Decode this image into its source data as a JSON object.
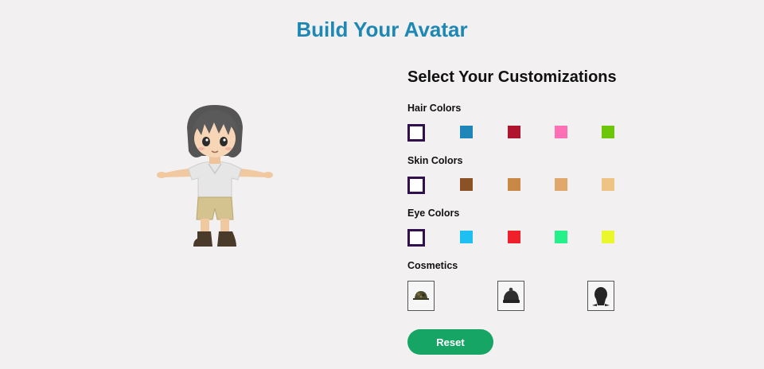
{
  "page": {
    "title": "Build Your Avatar"
  },
  "panel": {
    "title": "Select Your Customizations",
    "hair": {
      "label": "Hair Colors",
      "colors": [
        "#ffffff",
        "#1e86b8",
        "#b0132e",
        "#ff6fb6",
        "#6cc70a"
      ],
      "selected": 0
    },
    "skin": {
      "label": "Skin Colors",
      "colors": [
        "#ffffff",
        "#8b5325",
        "#c98845",
        "#e0a96b",
        "#eec384"
      ],
      "selected": 0
    },
    "eyes": {
      "label": "Eye Colors",
      "colors": [
        "#ffffff",
        "#1ec0f2",
        "#f0202a",
        "#26f08a",
        "#eaf72a"
      ],
      "selected": 0
    },
    "cosmetics": {
      "label": "Cosmetics",
      "items": [
        "camo-cap-icon",
        "beanie-icon",
        "hood-icon"
      ]
    },
    "reset_label": "Reset"
  },
  "colors": {
    "title": "#1e88b4",
    "accent": "#17a565",
    "selected_border": "#32104e",
    "background": "#f2f0f1"
  }
}
